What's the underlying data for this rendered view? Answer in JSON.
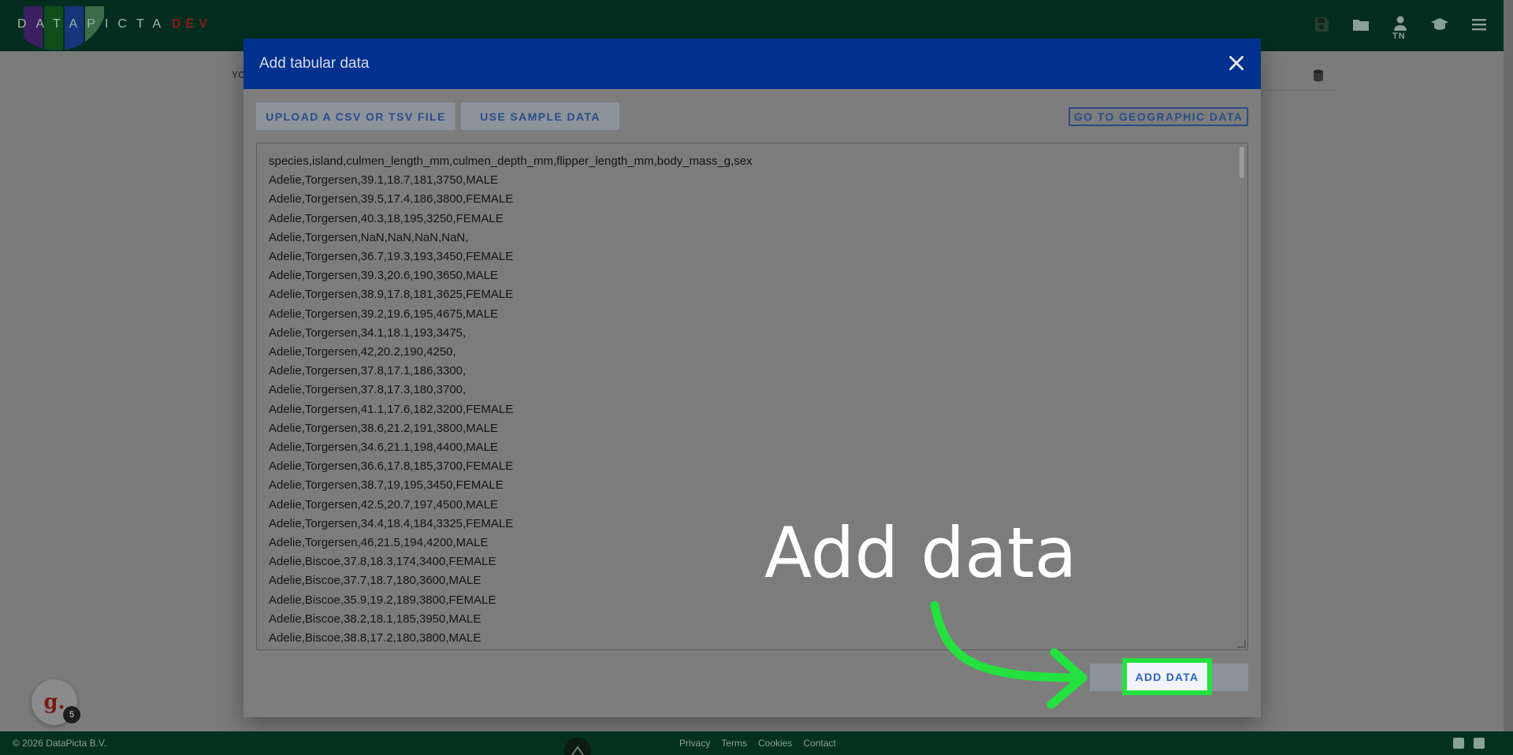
{
  "app": {
    "logo_text": "DATAPICTA",
    "logo_env": "DEV",
    "logo_bar_colors": [
      "#3d1f63",
      "#0f4d1c",
      "#16357a",
      "#3b6b4a"
    ]
  },
  "topbar": {
    "icons": [
      "save-icon",
      "folder-open-icon",
      "user-icon",
      "graduation-cap-icon",
      "menu-icon"
    ],
    "user_initials": "TN"
  },
  "background": {
    "tab_label": "YO"
  },
  "modal": {
    "title": "Add tabular data",
    "upload_label": "UPLOAD A CSV OR TSV FILE",
    "sample_label": "USE SAMPLE DATA",
    "geo_label": "GO TO GEOGRAPHIC DATA",
    "add_label": "ADD DATA",
    "textarea_text": "species,island,culmen_length_mm,culmen_depth_mm,flipper_length_mm,body_mass_g,sex\nAdelie,Torgersen,39.1,18.7,181,3750,MALE\nAdelie,Torgersen,39.5,17.4,186,3800,FEMALE\nAdelie,Torgersen,40.3,18,195,3250,FEMALE\nAdelie,Torgersen,NaN,NaN,NaN,NaN,\nAdelie,Torgersen,36.7,19.3,193,3450,FEMALE\nAdelie,Torgersen,39.3,20.6,190,3650,MALE\nAdelie,Torgersen,38.9,17.8,181,3625,FEMALE\nAdelie,Torgersen,39.2,19.6,195,4675,MALE\nAdelie,Torgersen,34.1,18.1,193,3475,\nAdelie,Torgersen,42,20.2,190,4250,\nAdelie,Torgersen,37.8,17.1,186,3300,\nAdelie,Torgersen,37.8,17.3,180,3700,\nAdelie,Torgersen,41.1,17.6,182,3200,FEMALE\nAdelie,Torgersen,38.6,21.2,191,3800,MALE\nAdelie,Torgersen,34.6,21.1,198,4400,MALE\nAdelie,Torgersen,36.6,17.8,185,3700,FEMALE\nAdelie,Torgersen,38.7,19,195,3450,FEMALE\nAdelie,Torgersen,42.5,20.7,197,4500,MALE\nAdelie,Torgersen,34.4,18.4,184,3325,FEMALE\nAdelie,Torgersen,46,21.5,194,4200,MALE\nAdelie,Biscoe,37.8,18.3,174,3400,FEMALE\nAdelie,Biscoe,37.7,18.7,180,3600,MALE\nAdelie,Biscoe,35.9,19.2,189,3800,FEMALE\nAdelie,Biscoe,38.2,18.1,185,3950,MALE\nAdelie,Biscoe,38.8,17.2,180,3800,MALE"
  },
  "annotation": {
    "text": "Add data",
    "color": "#23e13f"
  },
  "chat": {
    "letter": "g.",
    "badge_count": "5"
  },
  "footer": {
    "copyright": "© 2026 DataPicta B.V.",
    "links": [
      "Privacy",
      "Terms",
      "Cookies",
      "Contact"
    ],
    "social_icons": [
      "youtube-icon",
      "linkedin-icon"
    ]
  }
}
